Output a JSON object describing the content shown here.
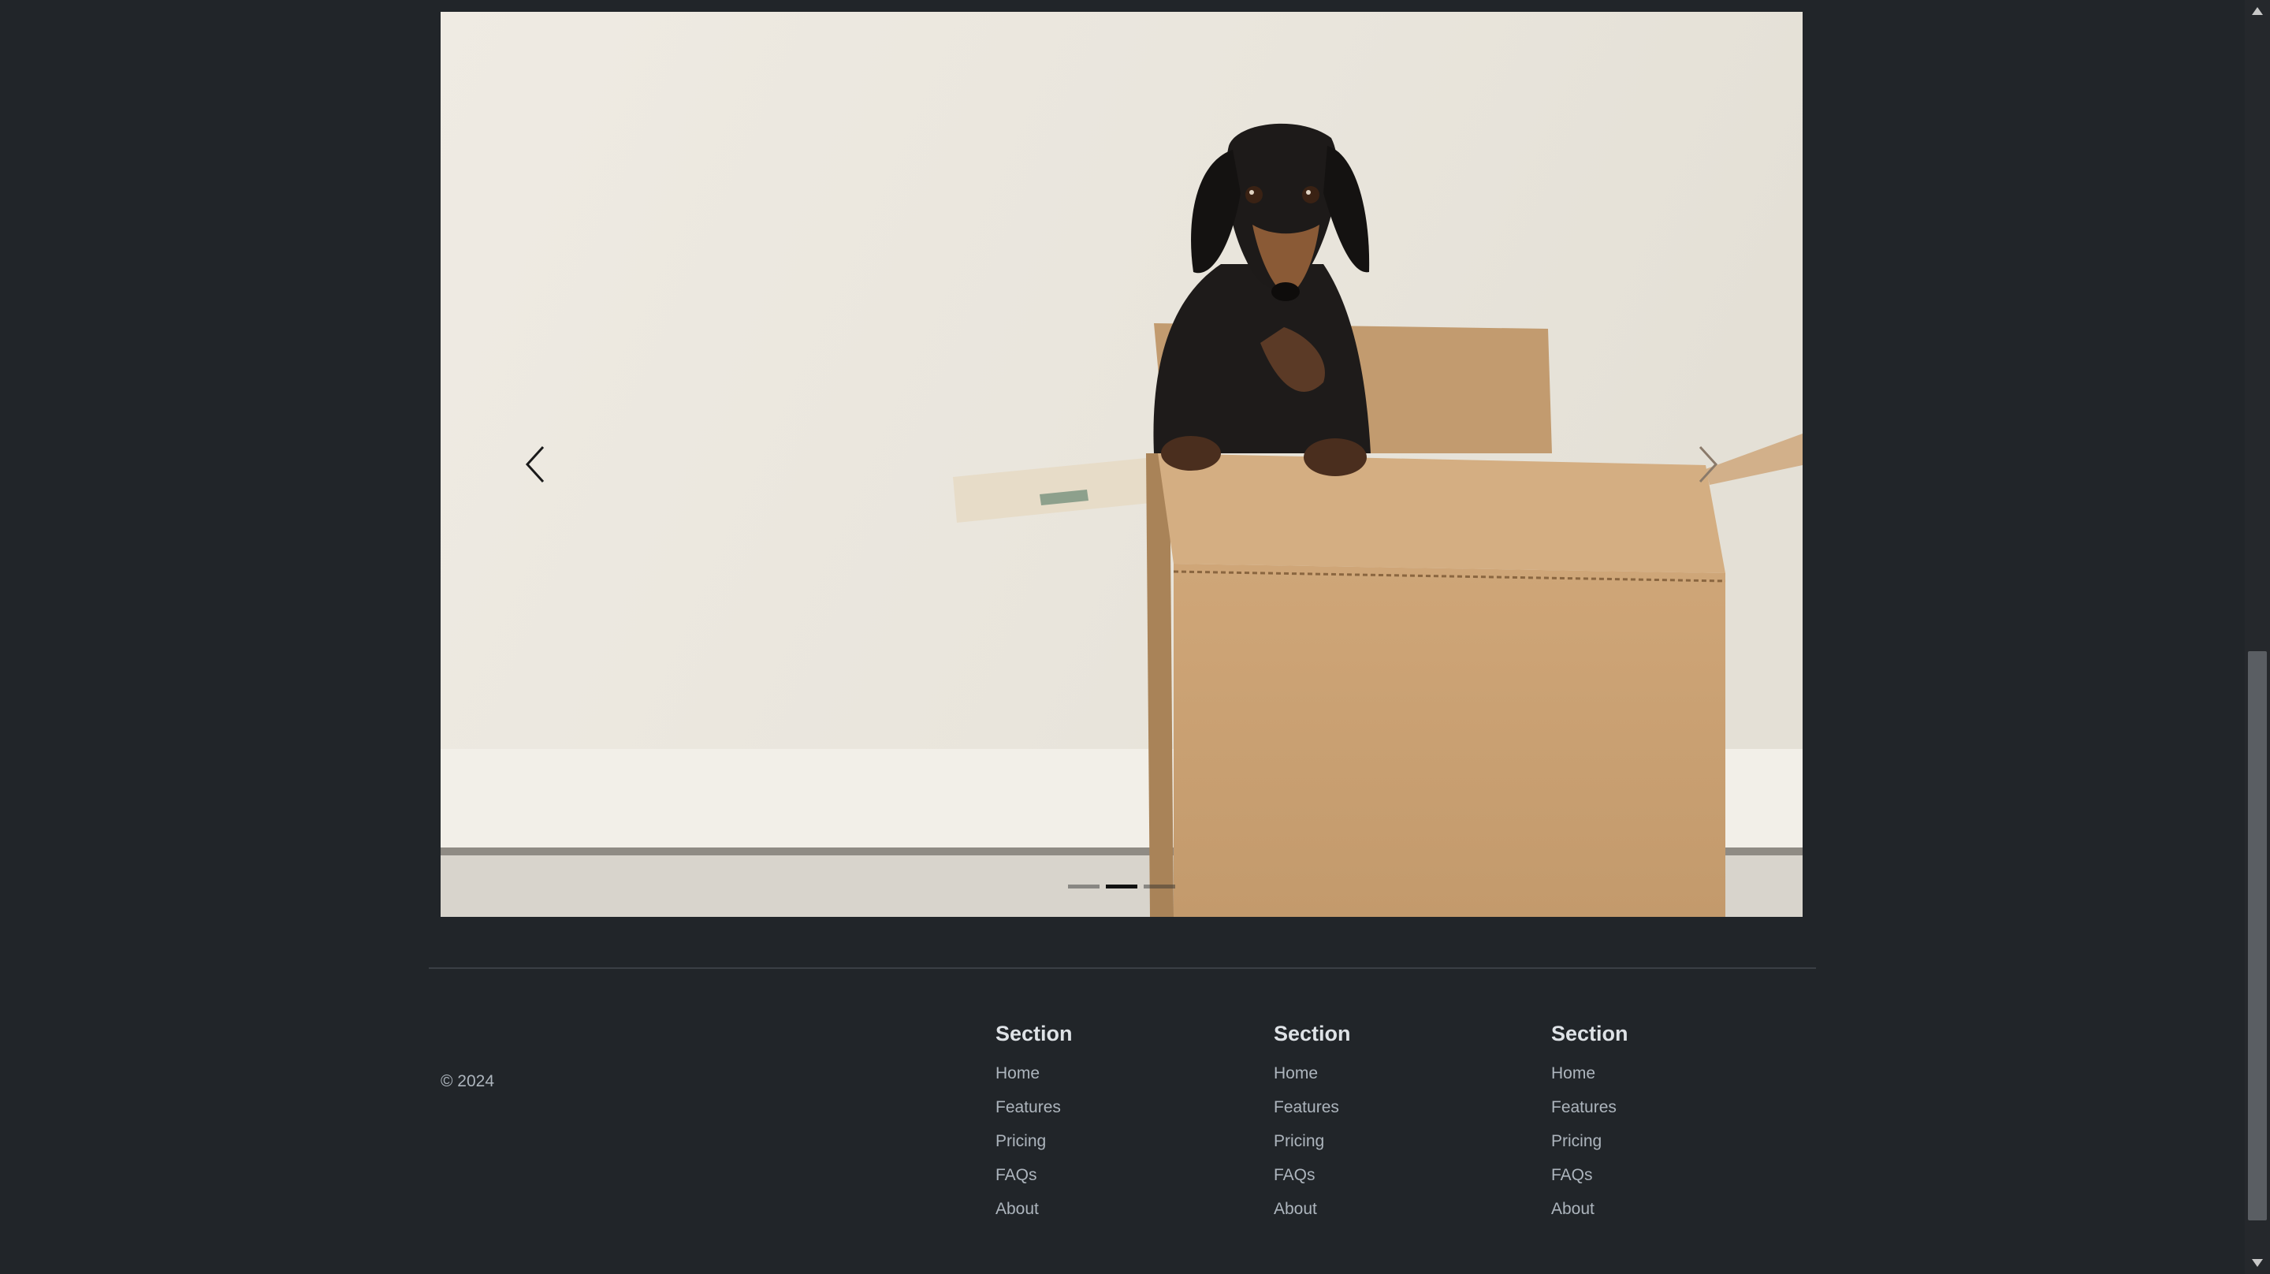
{
  "carousel": {
    "slide_alt": "Dachshund in a cardboard box",
    "prev_label": "Previous",
    "next_label": "Next",
    "indicators": [
      {
        "label": "Slide 1",
        "active": false
      },
      {
        "label": "Slide 2",
        "active": true
      },
      {
        "label": "Slide 3",
        "active": false
      }
    ]
  },
  "footer": {
    "copyright": "© 2024",
    "columns": [
      {
        "title": "Section",
        "links": [
          "Home",
          "Features",
          "Pricing",
          "FAQs",
          "About"
        ]
      },
      {
        "title": "Section",
        "links": [
          "Home",
          "Features",
          "Pricing",
          "FAQs",
          "About"
        ]
      },
      {
        "title": "Section",
        "links": [
          "Home",
          "Features",
          "Pricing",
          "FAQs",
          "About"
        ]
      }
    ]
  },
  "colors": {
    "page_background": "#212529",
    "footer_heading": "#dee2e6",
    "footer_link": "#adb5bd",
    "wall": "#ece8e0",
    "box": "#c9a47a"
  }
}
